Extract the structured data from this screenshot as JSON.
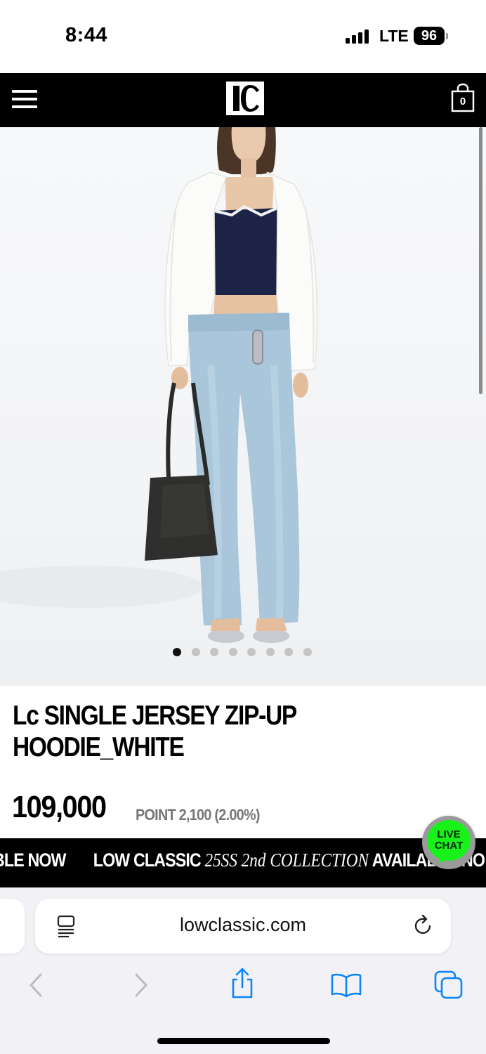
{
  "status_bar": {
    "time": "8:44",
    "network": "LTE",
    "battery": "96"
  },
  "header": {
    "menu_icon": "hamburger-menu-icon",
    "logo_icon": "lc-logo-icon",
    "cart_count": "0"
  },
  "gallery": {
    "image_description": "model-photo",
    "total_slides": 8,
    "active_slide": 1
  },
  "product": {
    "title_line1": "Lc SINGLE JERSEY ZIP-UP",
    "title_line2": "HOODIE_WHITE",
    "price": "109,000",
    "points": "POINT 2,100 (2.00%)"
  },
  "marquee": {
    "lead_fragment": "BLE NOW",
    "brand": "LOW CLASSIC",
    "collection": "25SS 2nd COLLECTION",
    "available": "AVAILABLE NO"
  },
  "live_chat": {
    "line1": "LIVE",
    "line2": "CHAT"
  },
  "browser": {
    "url": "lowclassic.com",
    "icons": [
      "reader-icon",
      "reload-icon",
      "back-icon",
      "forward-icon",
      "share-icon",
      "bookmarks-icon",
      "tabs-icon"
    ]
  },
  "colors": {
    "header_bg": "#000000",
    "live_chat_green": "#18f21a",
    "browser_accent": "#0a84ff"
  }
}
